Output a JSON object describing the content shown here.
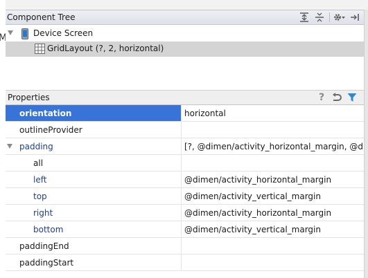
{
  "component_tree": {
    "title": "Component Tree",
    "tools": [
      "expand-all-icon",
      "collapse-all-icon",
      "gear-icon",
      "hide-panel-icon"
    ],
    "nodes": [
      {
        "label": "Device Screen",
        "icon": "device-icon"
      },
      {
        "label": "GridLayout (?, 2, horizontal)",
        "icon": "grid-layout-icon",
        "selected": true
      }
    ]
  },
  "properties": {
    "title": "Properties",
    "tools": [
      "help-icon",
      "restore-icon",
      "filter-icon"
    ],
    "rows": [
      {
        "name": "orientation",
        "value": "horizontal",
        "selected": true
      },
      {
        "name": "outlineProvider",
        "value": ""
      },
      {
        "name": "padding",
        "value": "[?, @dimen/activity_horizontal_margin, @dimen",
        "expandable": true
      },
      {
        "name": "all",
        "value": ""
      },
      {
        "name": "left",
        "value": "@dimen/activity_horizontal_margin"
      },
      {
        "name": "top",
        "value": "@dimen/activity_vertical_margin"
      },
      {
        "name": "right",
        "value": "@dimen/activity_horizontal_margin"
      },
      {
        "name": "bottom",
        "value": "@dimen/activity_vertical_margin"
      },
      {
        "name": "paddingEnd",
        "value": ""
      },
      {
        "name": "paddingStart",
        "value": ""
      }
    ]
  },
  "colors": {
    "selection": "#3874d8",
    "modified_text": "#1e3f9c",
    "filter_active": "#2a8ad4"
  }
}
